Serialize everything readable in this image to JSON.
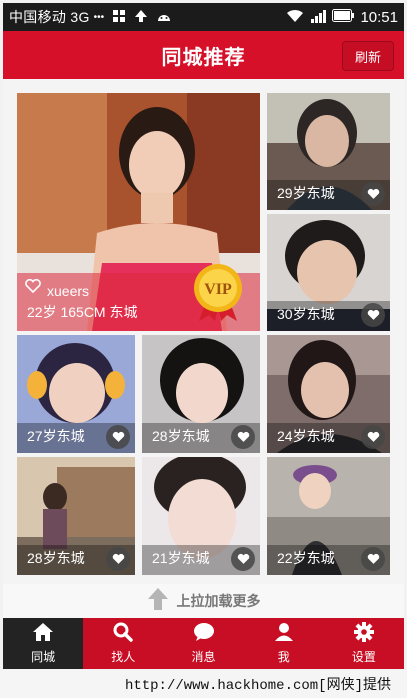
{
  "statusbar": {
    "carrier": "中国移动 3G",
    "dots": "•••",
    "time": "10:51"
  },
  "header": {
    "title": "同城推荐",
    "refresh_label": "刷新"
  },
  "featured": {
    "name": "xueers",
    "details": "22岁 165CM 东城",
    "badge": "VIP"
  },
  "tiles": [
    {
      "label": "29岁东城"
    },
    {
      "label": "30岁东城"
    },
    {
      "label": "27岁东城"
    },
    {
      "label": "28岁东城"
    },
    {
      "label": "24岁东城"
    },
    {
      "label": "28岁东城"
    },
    {
      "label": "21岁东城"
    },
    {
      "label": "22岁东城"
    }
  ],
  "loadmore": {
    "text": "上拉加载更多"
  },
  "nav": [
    {
      "label": "同城",
      "icon": "home-icon"
    },
    {
      "label": "找人",
      "icon": "search-icon"
    },
    {
      "label": "消息",
      "icon": "chat-icon"
    },
    {
      "label": "我",
      "icon": "person-icon"
    },
    {
      "label": "设置",
      "icon": "gear-icon"
    }
  ],
  "footer": {
    "text": "http://www.hackhome.com[网侠]提供"
  },
  "colors": {
    "brand": "#d7102a",
    "nav_active": "#232323"
  }
}
